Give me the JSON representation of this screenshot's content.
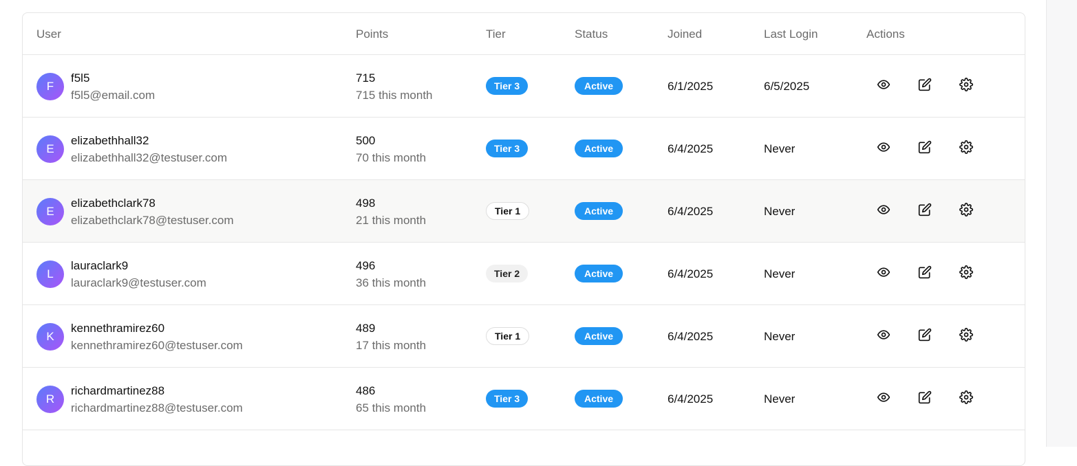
{
  "table": {
    "headers": {
      "user": "User",
      "points": "Points",
      "tier": "Tier",
      "status": "Status",
      "joined": "Joined",
      "last_login": "Last Login",
      "actions": "Actions"
    },
    "rows": [
      {
        "initial": "F",
        "username": "f5l5",
        "email": "f5l5@email.com",
        "points": "715",
        "month": "715 this month",
        "tier": "Tier 3",
        "tier_style": "t3",
        "status": "Active",
        "joined": "6/1/2025",
        "last_login": "6/5/2025",
        "shaded": false
      },
      {
        "initial": "E",
        "username": "elizabethhall32",
        "email": "elizabethhall32@testuser.com",
        "points": "500",
        "month": "70 this month",
        "tier": "Tier 3",
        "tier_style": "t3",
        "status": "Active",
        "joined": "6/4/2025",
        "last_login": "Never",
        "shaded": false
      },
      {
        "initial": "E",
        "username": "elizabethclark78",
        "email": "elizabethclark78@testuser.com",
        "points": "498",
        "month": "21 this month",
        "tier": "Tier 1",
        "tier_style": "t1",
        "status": "Active",
        "joined": "6/4/2025",
        "last_login": "Never",
        "shaded": true
      },
      {
        "initial": "L",
        "username": "lauraclark9",
        "email": "lauraclark9@testuser.com",
        "points": "496",
        "month": "36 this month",
        "tier": "Tier 2",
        "tier_style": "t2",
        "status": "Active",
        "joined": "6/4/2025",
        "last_login": "Never",
        "shaded": false
      },
      {
        "initial": "K",
        "username": "kennethramirez60",
        "email": "kennethramirez60@testuser.com",
        "points": "489",
        "month": "17 this month",
        "tier": "Tier 1",
        "tier_style": "t1",
        "status": "Active",
        "joined": "6/4/2025",
        "last_login": "Never",
        "shaded": false
      },
      {
        "initial": "R",
        "username": "richardmartinez88",
        "email": "richardmartinez88@testuser.com",
        "points": "486",
        "month": "65 this month",
        "tier": "Tier 3",
        "tier_style": "t3",
        "status": "Active",
        "joined": "6/4/2025",
        "last_login": "Never",
        "shaded": false
      }
    ],
    "row_actions": [
      "eye-icon",
      "edit-icon",
      "gear-icon"
    ]
  },
  "colors": {
    "accent": "#2196f3",
    "avatar_gradient_start": "#5b7cfa",
    "avatar_gradient_end": "#a855f7",
    "muted_text": "#6b6b6b"
  }
}
